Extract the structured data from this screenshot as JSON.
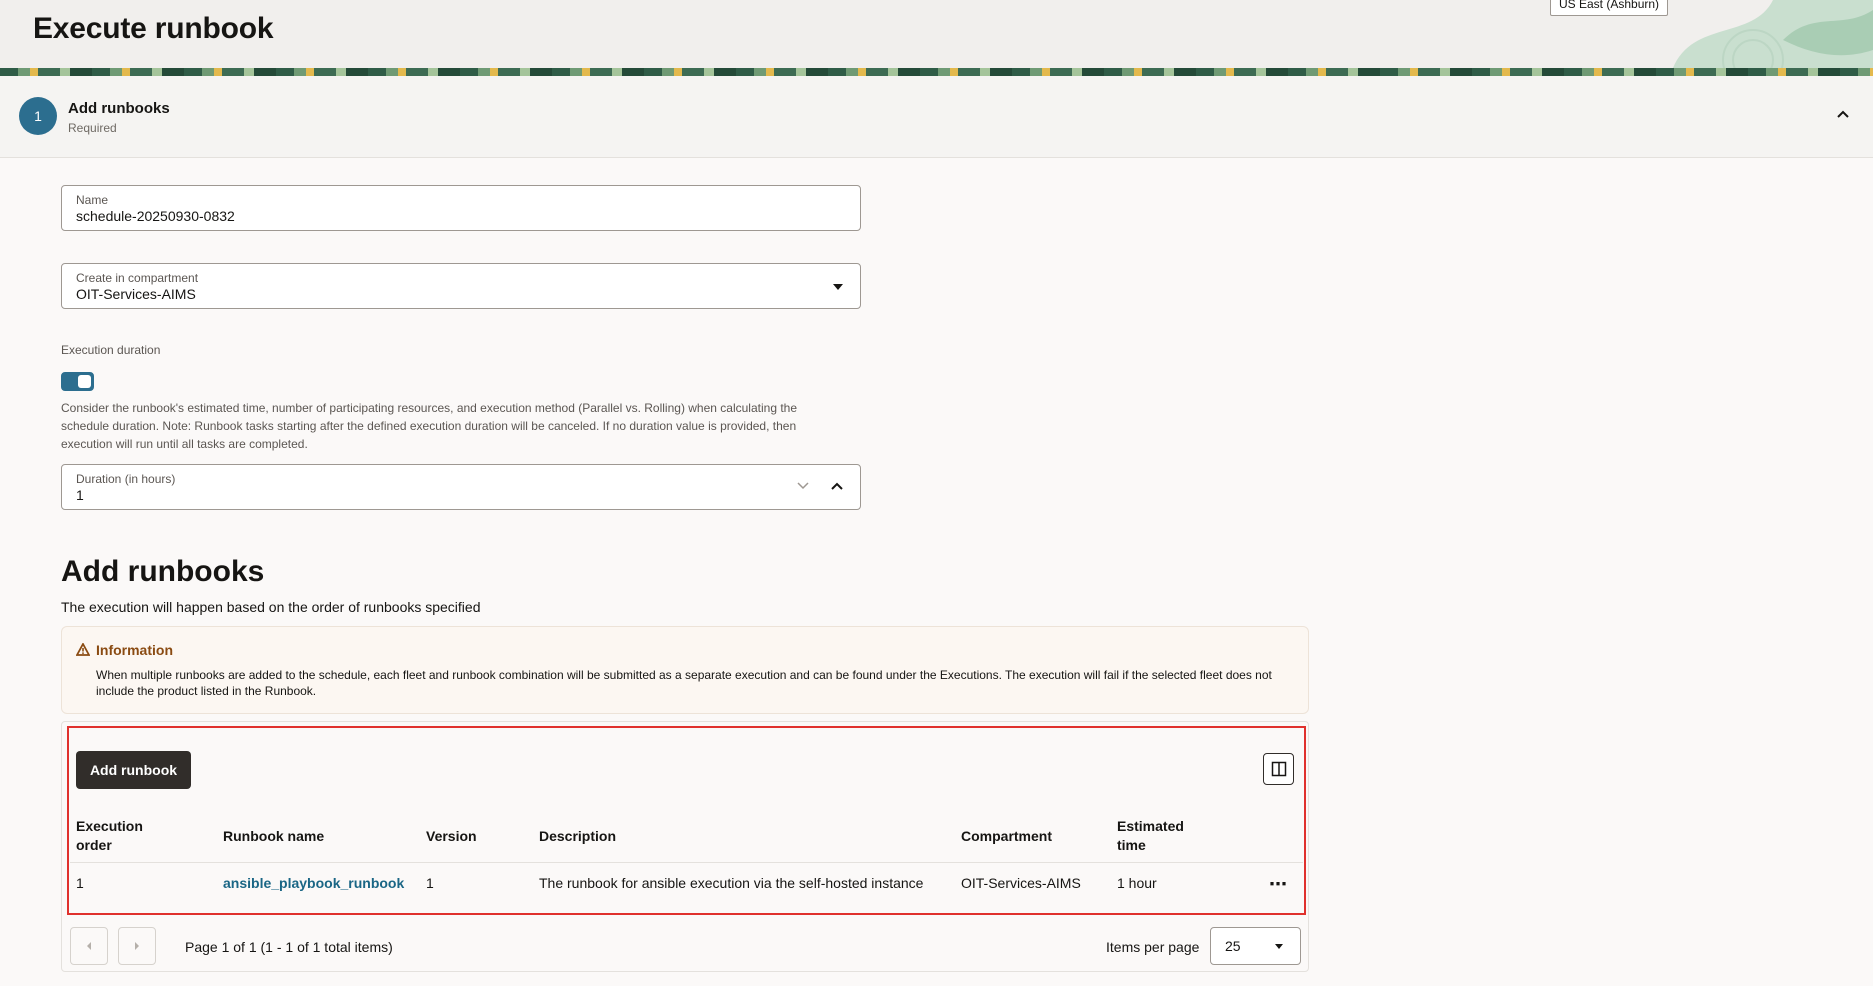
{
  "header": {
    "title": "Execute runbook",
    "region": "US East (Ashburn)"
  },
  "step": {
    "number": "1",
    "title": "Add runbooks",
    "subtitle": "Required"
  },
  "form": {
    "name": {
      "label": "Name",
      "value": "schedule-20250930-0832"
    },
    "compartment": {
      "label": "Create in compartment",
      "value": "OIT-Services-AIMS"
    },
    "execution_duration": {
      "label": "Execution duration",
      "enabled": true,
      "help": "Consider the runbook's estimated time, number of participating resources, and execution method (Parallel vs. Rolling) when calculating the schedule duration. Note: Runbook tasks starting after the defined execution duration will be canceled. If no duration value is provided, then execution will run until all tasks are completed."
    },
    "duration": {
      "label": "Duration (in hours)",
      "value": "1"
    }
  },
  "runbooks_section": {
    "title": "Add runbooks",
    "subtitle": "The execution will happen based on the order of runbooks specified",
    "info": {
      "title": "Information",
      "text": "When multiple runbooks are added to the schedule, each fleet and runbook combination will be submitted as a separate execution and can be found under the Executions. The execution will fail if the selected fleet does not include the product listed in the Runbook."
    },
    "add_button": "Add runbook"
  },
  "table": {
    "columns": [
      "Execution order",
      "Runbook name",
      "Version",
      "Description",
      "Compartment",
      "Estimated time"
    ],
    "rows": [
      {
        "order": "1",
        "name": "ansible_playbook_runbook",
        "version": "1",
        "description": "The runbook for ansible execution via the self-hosted instance",
        "compartment": "OIT-Services-AIMS",
        "estimated_time": "1 hour"
      }
    ]
  },
  "pagination": {
    "summary": "Page 1 of 1 (1 - 1 of 1 total items)",
    "items_per_page_label": "Items per page",
    "items_per_page": "25"
  },
  "colors": {
    "accent": "#2c6e8f",
    "primary_button": "#312d2a",
    "highlight_outline": "#e0312d",
    "info_title": "#8a4b12",
    "link": "#1a6685"
  }
}
